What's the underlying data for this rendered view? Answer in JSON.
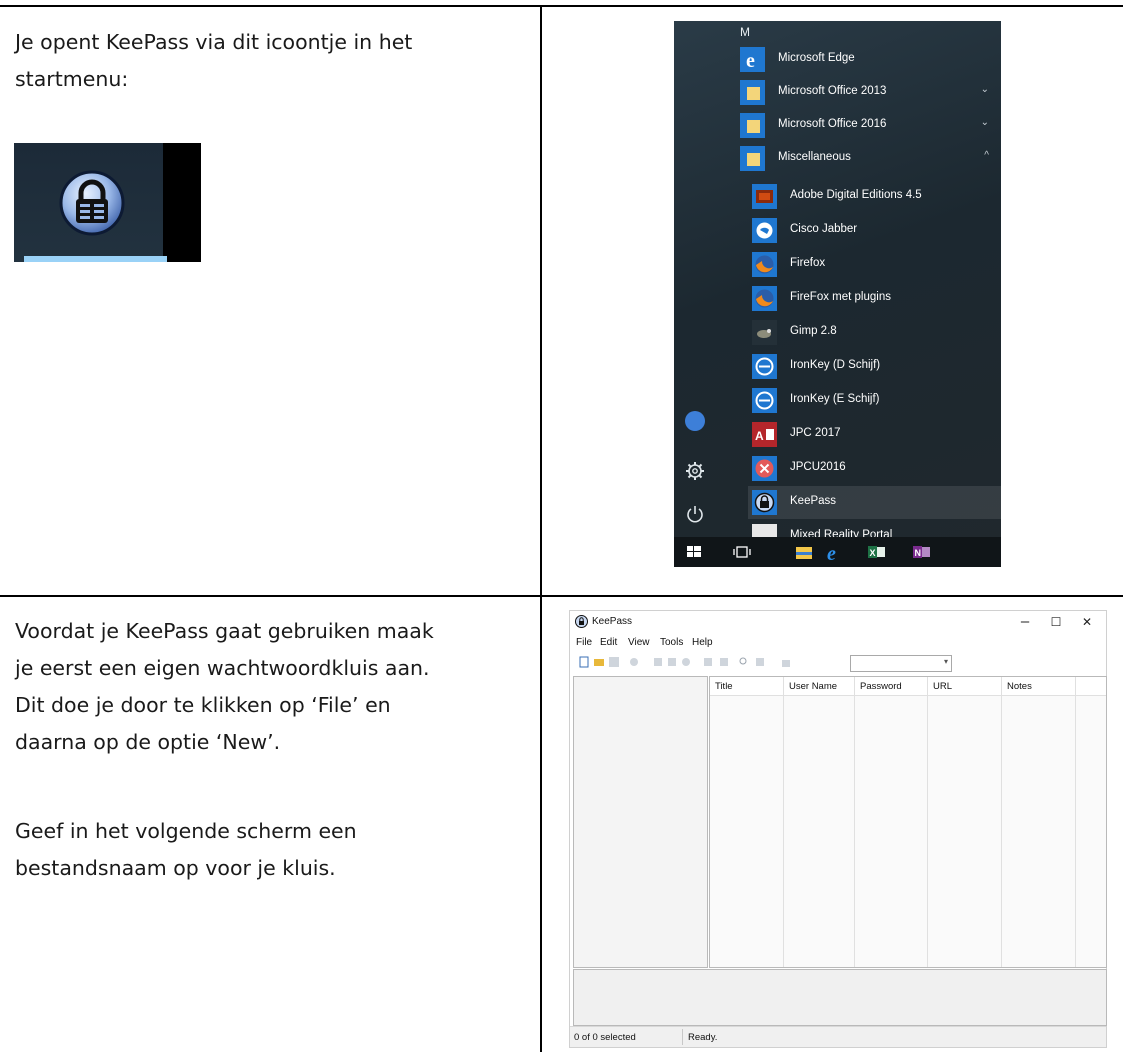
{
  "row1": {
    "text_lines": [
      "Je opent KeePass via dit icoontje in het",
      "startmenu:"
    ]
  },
  "startmenu": {
    "letter": "M",
    "items": [
      {
        "label": "Microsoft Edge",
        "icon": "edge-icon"
      },
      {
        "label": "Microsoft Office 2013",
        "icon": "folder-icon",
        "chevron": "⌄"
      },
      {
        "label": "Microsoft Office 2016",
        "icon": "folder-icon",
        "chevron": "⌄"
      },
      {
        "label": "Miscellaneous",
        "icon": "folder-icon",
        "chevron": "^"
      },
      {
        "label": "Adobe Digital Editions 4.5",
        "icon": "adobe-digital-editions-icon"
      },
      {
        "label": "Cisco Jabber",
        "icon": "cisco-jabber-icon"
      },
      {
        "label": "Firefox",
        "icon": "firefox-icon"
      },
      {
        "label": "FireFox  met plugins",
        "icon": "firefox-icon"
      },
      {
        "label": "Gimp 2.8",
        "icon": "gimp-icon"
      },
      {
        "label": "IronKey (D Schijf)",
        "icon": "ironkey-icon"
      },
      {
        "label": "IronKey (E Schijf)",
        "icon": "ironkey-icon"
      },
      {
        "label": "JPC 2017",
        "icon": "access-icon"
      },
      {
        "label": "JPCU2016",
        "icon": "jpcu-icon"
      },
      {
        "label": "KeePass",
        "icon": "keepass-icon"
      },
      {
        "label": "Mixed Reality Portal",
        "icon": "mixed-reality-icon"
      }
    ]
  },
  "row2": {
    "text_lines": [
      "Voordat je KeePass gaat gebruiken maak",
      "je eerst een eigen wachtwoordkluis aan.",
      "Dit doe je door te klikken op ‘File’ en",
      "daarna op de optie ‘New’."
    ],
    "text_lines_2": [
      "Geef in het volgende scherm een",
      "bestandsnaam op voor je kluis."
    ]
  },
  "keepass_window": {
    "title": "KeePass",
    "menu": [
      "File",
      "Edit",
      "View",
      "Tools",
      "Help"
    ],
    "columns": [
      "Title",
      "User Name",
      "Password",
      "URL",
      "Notes"
    ],
    "status_selected": "0 of 0 selected",
    "status_ready": "Ready.",
    "minimize": "–",
    "maximize": "☐",
    "close": "✕"
  },
  "colors": {
    "win_blue": "#1f77d0",
    "folder_yellow": "#f3d57a",
    "keepass_tile": "#9ad2f7"
  }
}
